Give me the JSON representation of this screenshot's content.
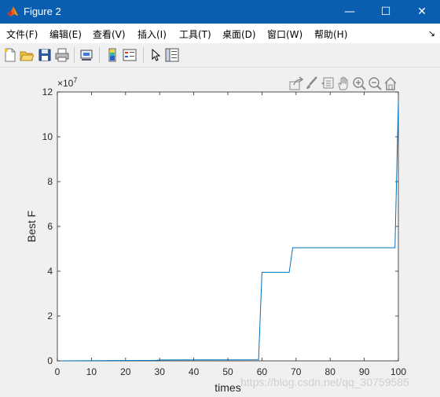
{
  "window": {
    "title": "Figure 2"
  },
  "window_controls": {
    "minimize": "—",
    "maximize": "☐",
    "close": "✕"
  },
  "menu": {
    "items": [
      "文件(F)",
      "编辑(E)",
      "查看(V)",
      "插入(I)",
      "工具(T)",
      "桌面(D)",
      "窗口(W)",
      "帮助(H)"
    ],
    "overflow": "↘"
  },
  "toolbar": {
    "icons": [
      "new-figure-icon",
      "open-file-icon",
      "save-icon",
      "print-icon",
      "link-plot-icon",
      "insert-colorbar-icon",
      "insert-legend-icon",
      "select-pointer-icon",
      "property-inspector-icon"
    ]
  },
  "axes_toolbar": {
    "icons": [
      "export-icon",
      "brush-icon",
      "data-tips-icon",
      "pan-icon",
      "zoom-in-icon",
      "zoom-out-icon",
      "home-icon"
    ]
  },
  "watermark": "https://blog.csdn.net/qq_30759585",
  "colors": {
    "titlebar": "#0a5eb0",
    "line": "#0072bd",
    "menubar": "#ffffff"
  },
  "chart_data": {
    "type": "line",
    "title": "",
    "xlabel": "times",
    "ylabel": "Best F",
    "exponent_label": "×10",
    "exponent_power": "7",
    "xlim": [
      0,
      100
    ],
    "ylim": [
      0,
      12
    ],
    "xticks": [
      0,
      10,
      20,
      30,
      40,
      50,
      60,
      70,
      80,
      90,
      100
    ],
    "yticks": [
      0,
      2,
      4,
      6,
      8,
      10,
      12
    ],
    "xticklabels": [
      "0",
      "10",
      "20",
      "30",
      "40",
      "50",
      "60",
      "70",
      "80",
      "90",
      "100"
    ],
    "yticklabels": [
      "0",
      "2",
      "4",
      "6",
      "8",
      "10",
      "12"
    ],
    "grid": false,
    "series": [
      {
        "x": [
          1,
          29,
          30,
          59,
          60,
          68,
          69,
          99,
          100
        ],
        "y": [
          0.0,
          0.02,
          0.04,
          0.05,
          3.95,
          3.95,
          5.05,
          5.05,
          11.6
        ]
      }
    ]
  }
}
